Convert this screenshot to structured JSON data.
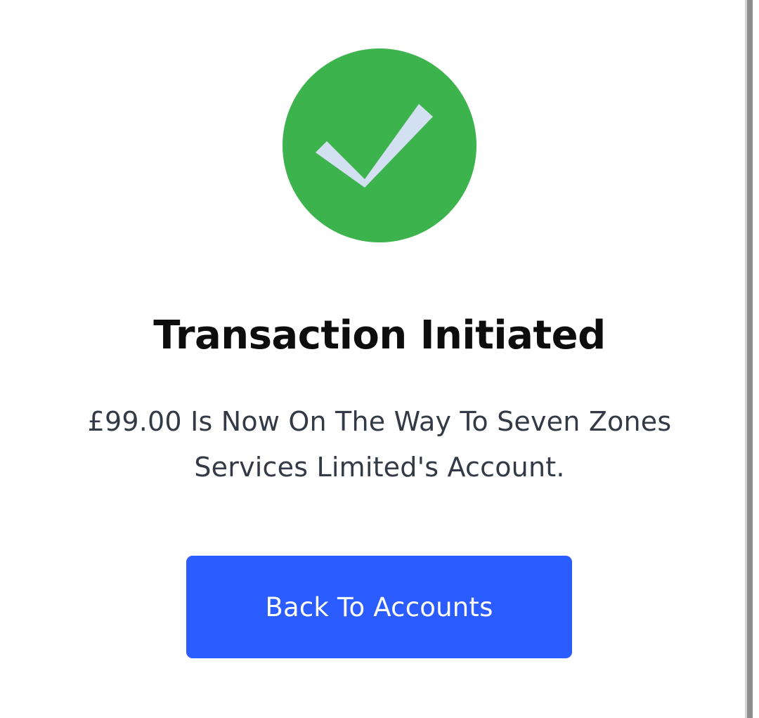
{
  "success": {
    "icon": "check-circle-icon",
    "circle_color": "#3db34d",
    "check_color": "#d3e0f2"
  },
  "title": "Transaction Initiated",
  "message": "£99.00 Is Now On The Way To Seven Zones Services Limited's Account.",
  "actions": {
    "back_label": "Back To Accounts",
    "button_color": "#2a5cff"
  }
}
